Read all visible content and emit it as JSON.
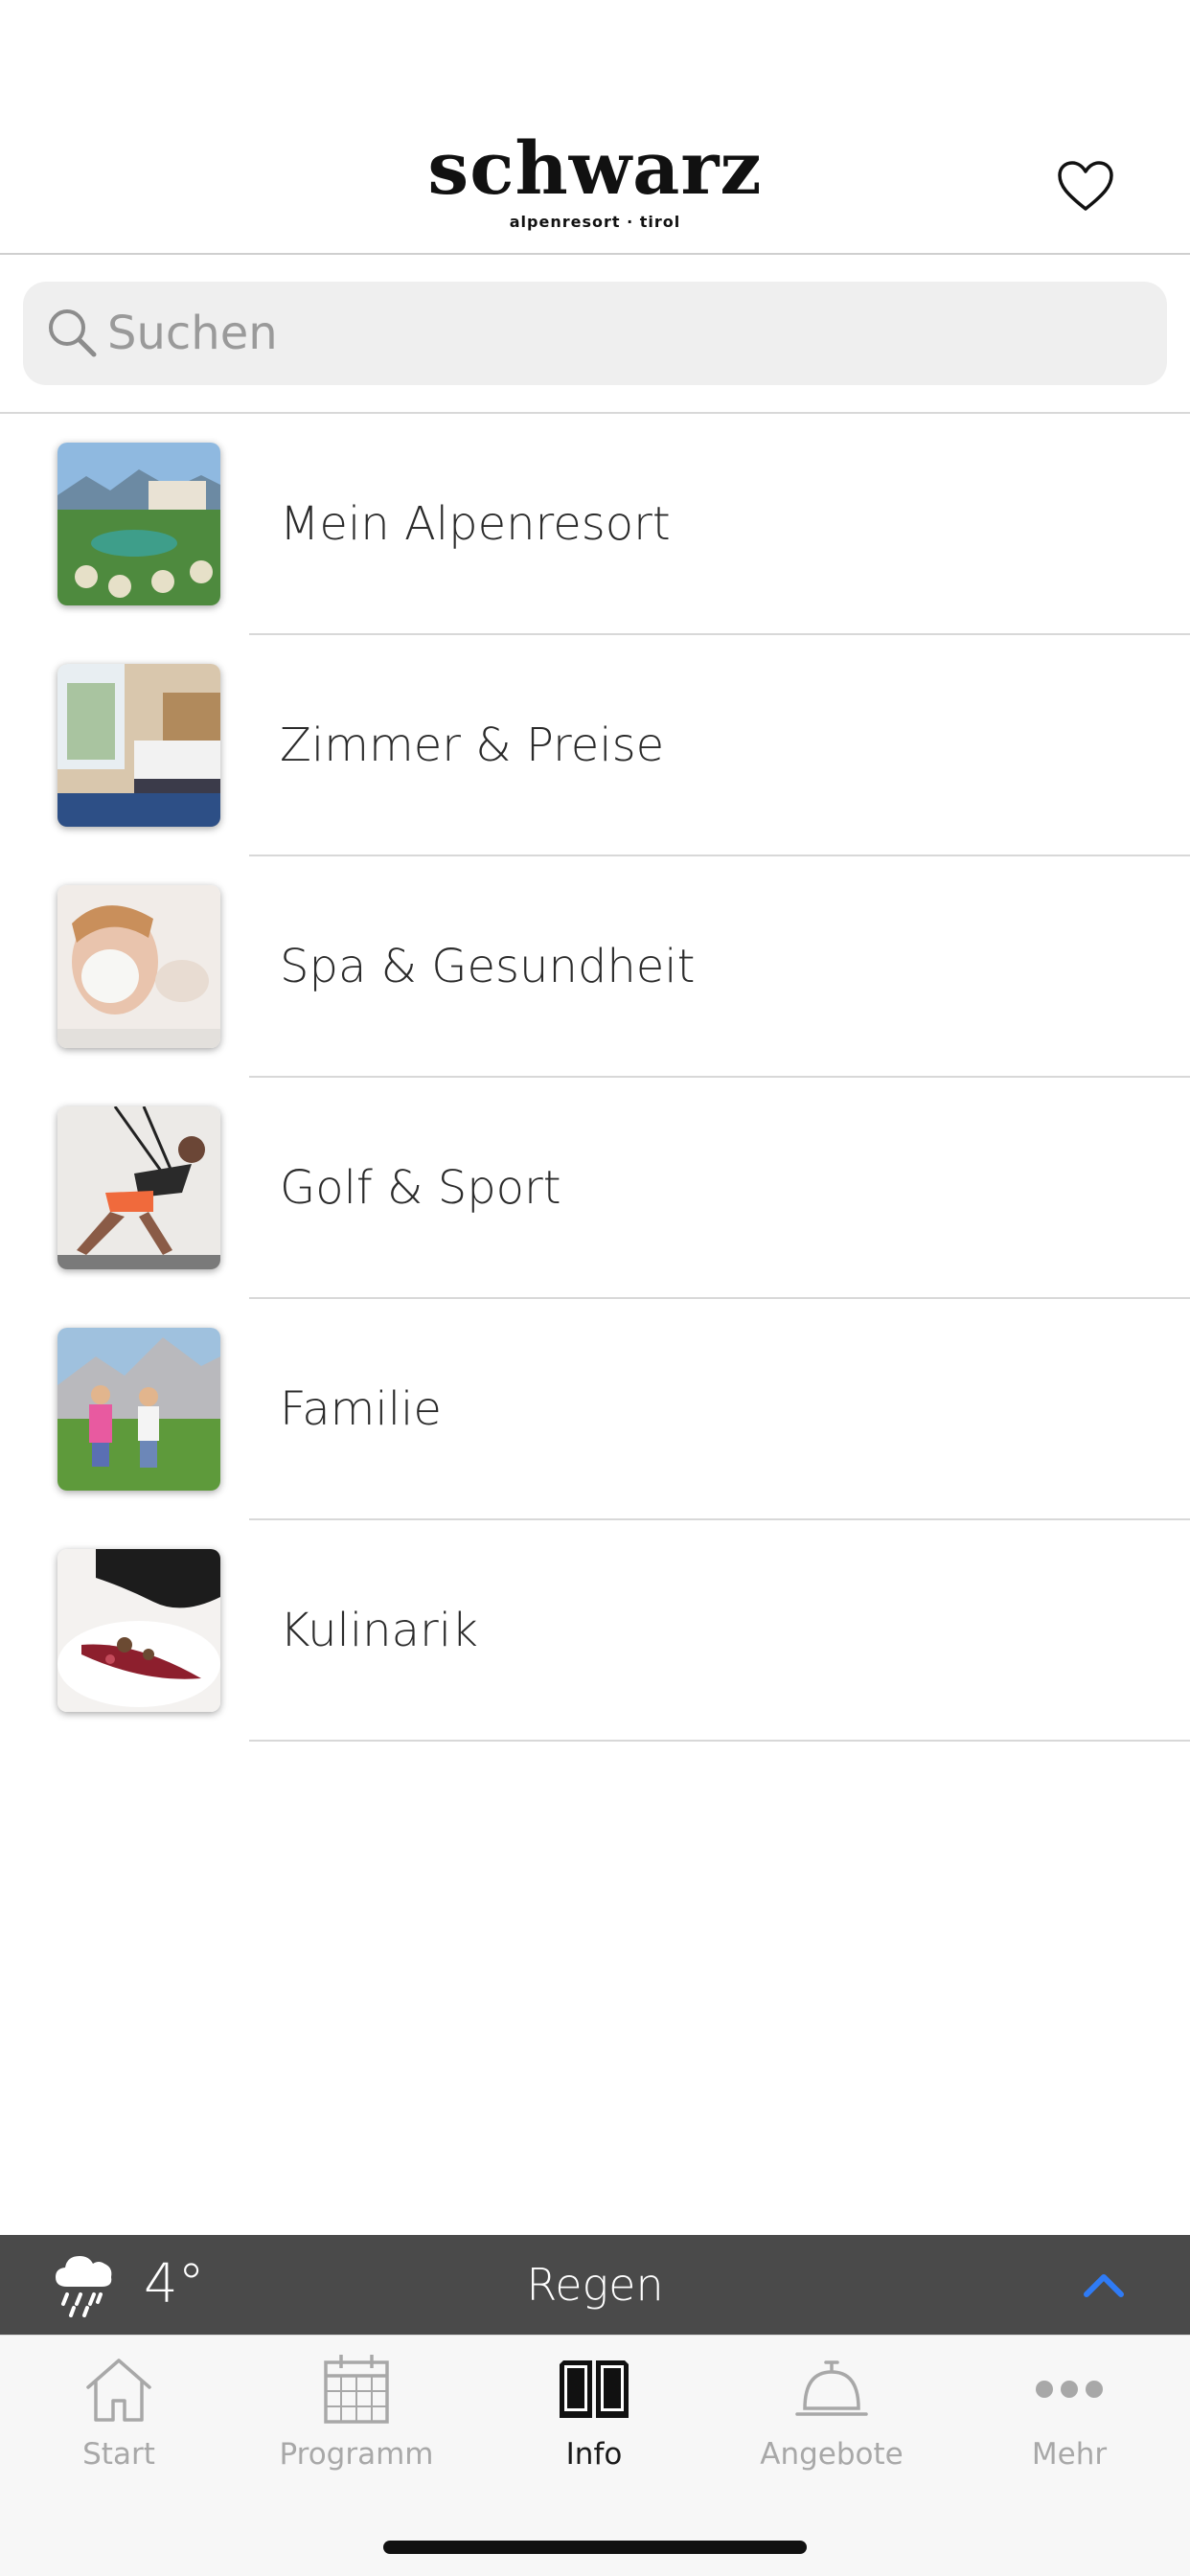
{
  "header": {
    "logo_text": "schwarz",
    "logo_subtitle": "alpenresort · tirol",
    "favorite_icon": "heart-outline-icon"
  },
  "search": {
    "placeholder": "Suchen",
    "value": "",
    "icon": "search-icon"
  },
  "menu": {
    "items": [
      {
        "label": "Mein Alpenresort",
        "thumbnail": "resort-photo"
      },
      {
        "label": "Zimmer & Preise",
        "thumbnail": "room-photo"
      },
      {
        "label": "Spa & Gesundheit",
        "thumbnail": "spa-photo"
      },
      {
        "label": "Golf & Sport",
        "thumbnail": "sport-photo"
      },
      {
        "label": "Familie",
        "thumbnail": "family-photo"
      },
      {
        "label": "Kulinarik",
        "thumbnail": "food-photo"
      }
    ]
  },
  "weather": {
    "temperature": "4°",
    "description": "Regen",
    "icon": "rain-cloud-icon",
    "expand_icon": "chevron-up-icon",
    "accent_color": "#2f7bf5",
    "bar_color": "#4a4a4a"
  },
  "tabbar": {
    "tabs": [
      {
        "label": "Start",
        "icon": "home-icon",
        "active": false
      },
      {
        "label": "Programm",
        "icon": "calendar-icon",
        "active": false
      },
      {
        "label": "Info",
        "icon": "book-icon",
        "active": true
      },
      {
        "label": "Angebote",
        "icon": "service-bell-icon",
        "active": false
      },
      {
        "label": "Mehr",
        "icon": "more-dots-icon",
        "active": false
      }
    ]
  }
}
